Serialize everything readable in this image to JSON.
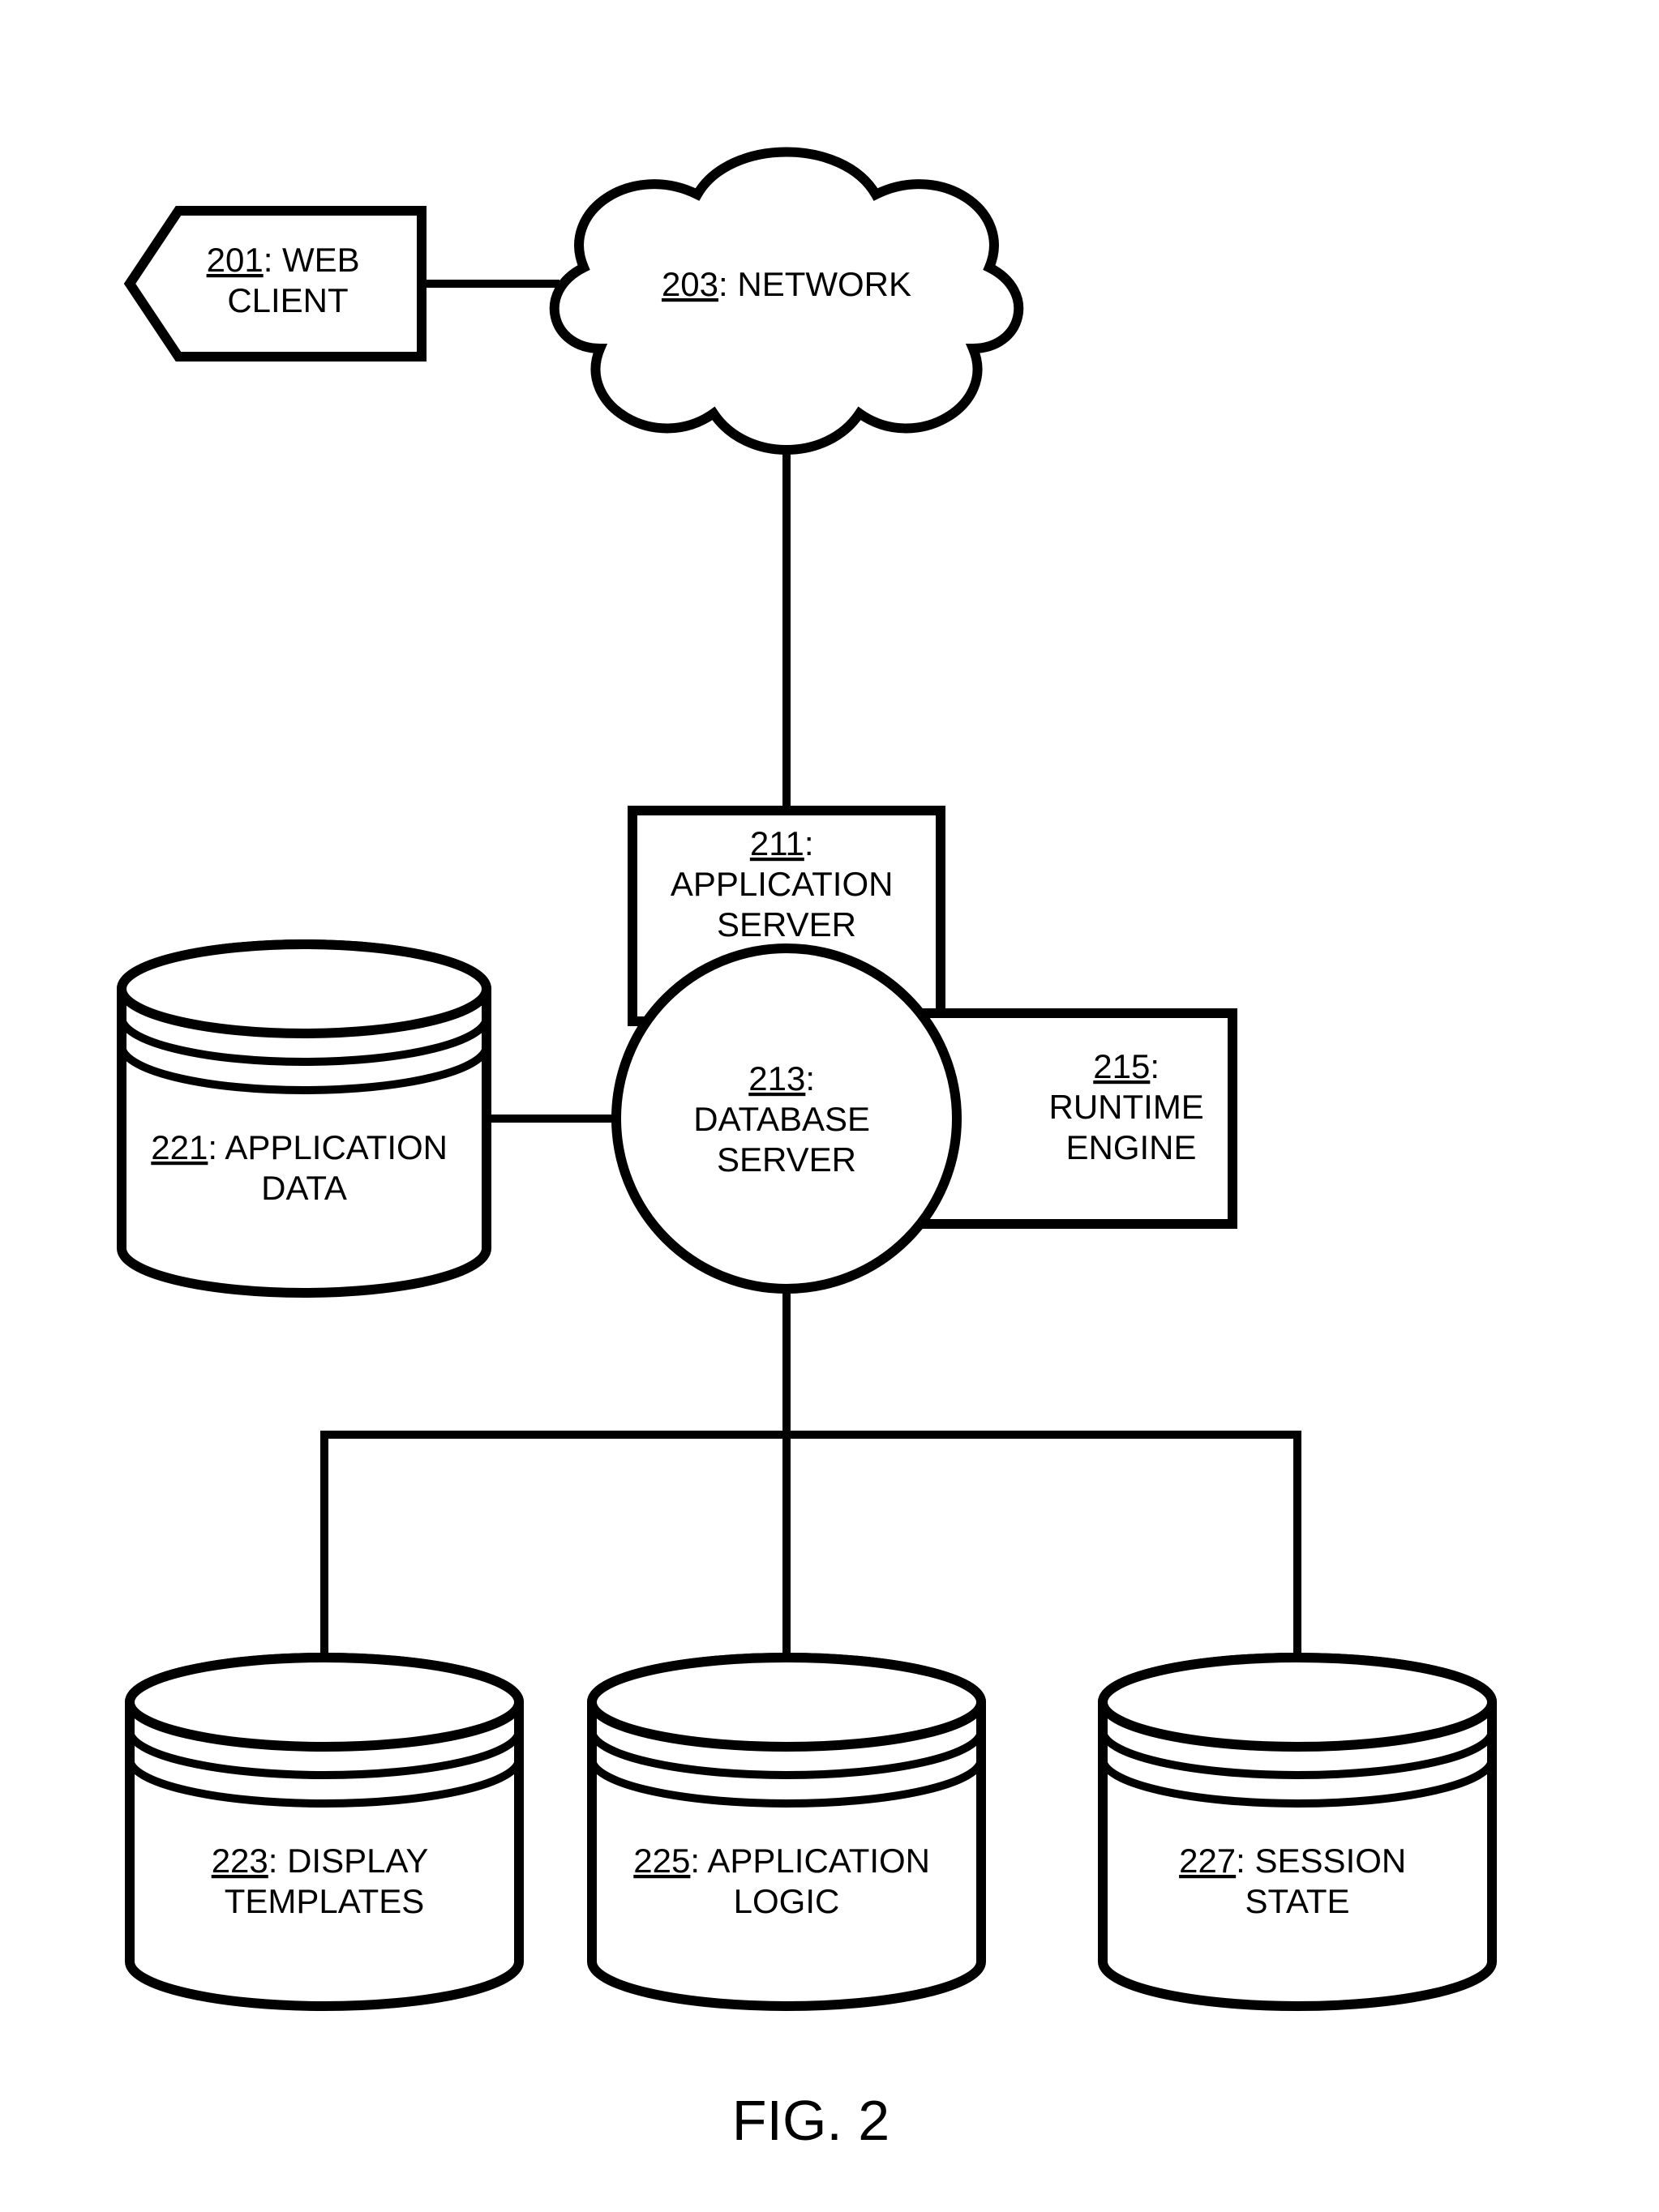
{
  "figure_label": "FIG. 2",
  "nodes": {
    "web_client": {
      "ref": "201",
      "label": "WEB CLIENT"
    },
    "network": {
      "ref": "203",
      "label": "NETWORK"
    },
    "app_server": {
      "ref": "211",
      "label": "APPLICATION SERVER"
    },
    "db_server": {
      "ref": "213",
      "label": "DATABASE SERVER"
    },
    "runtime_engine": {
      "ref": "215",
      "label": "RUNTIME ENGINE"
    },
    "app_data": {
      "ref": "221",
      "label": "APPLICATION DATA"
    },
    "display_templates": {
      "ref": "223",
      "label": "DISPLAY TEMPLATES"
    },
    "app_logic": {
      "ref": "225",
      "label": "APPLICATION LOGIC"
    },
    "session_state": {
      "ref": "227",
      "label": "SESSION STATE"
    }
  }
}
